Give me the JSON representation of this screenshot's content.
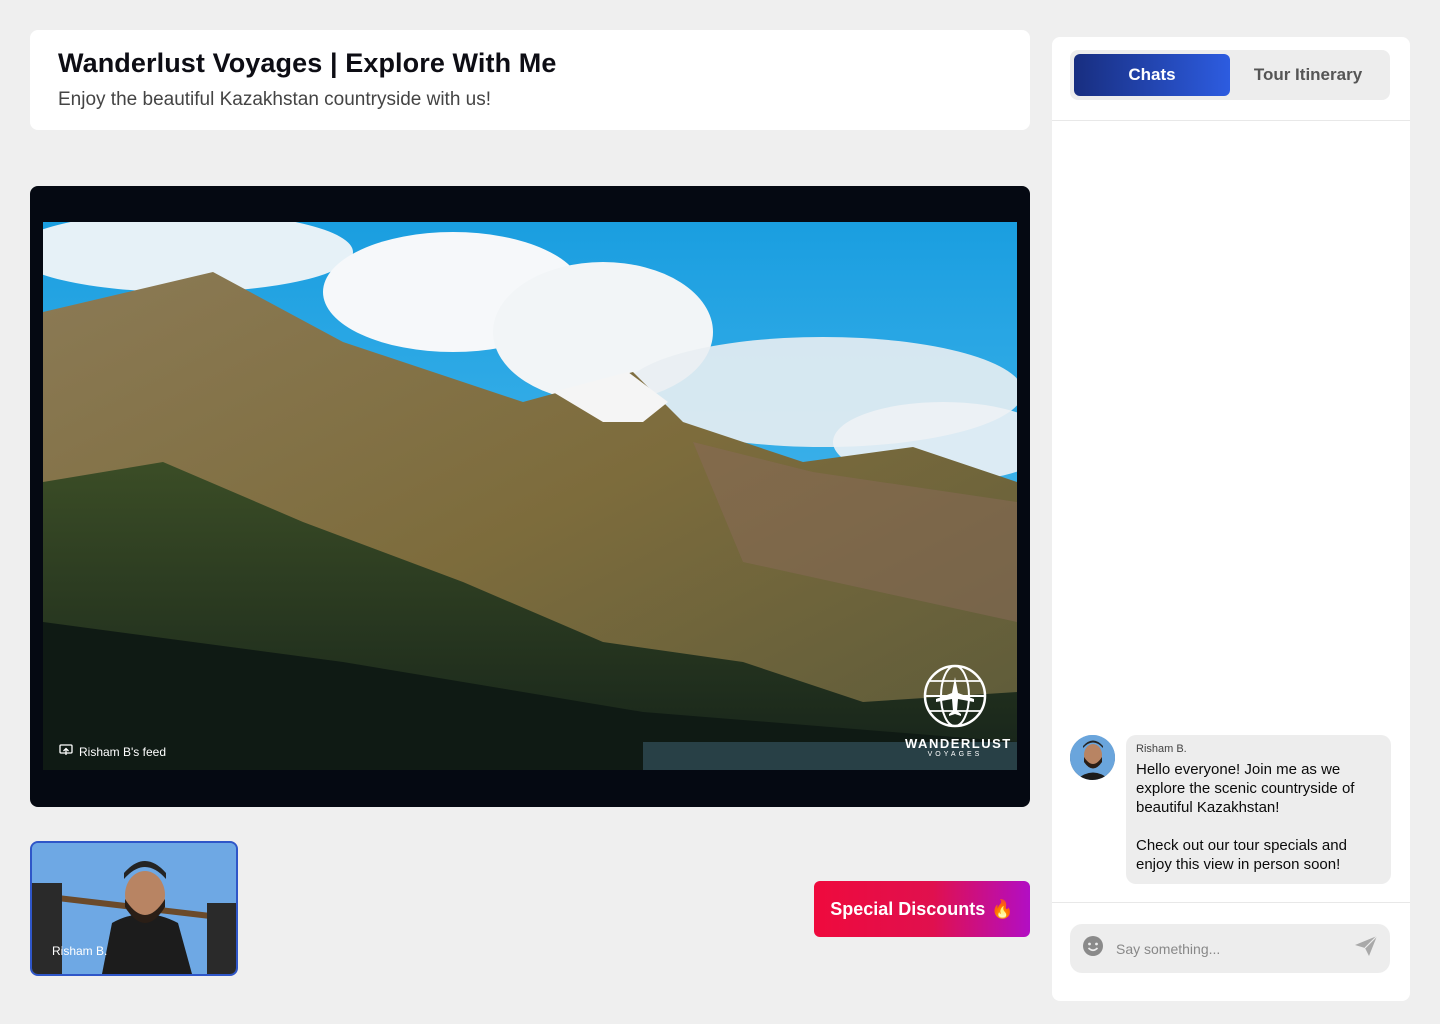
{
  "header": {
    "title": "Wanderlust Voyages | Explore With Me",
    "subtitle": "Enjoy the beautiful Kazakhstan countryside with us!"
  },
  "video": {
    "feed_label": "Risham B's feed",
    "brand_name": "WANDERLUST",
    "brand_sub": "VOYAGES"
  },
  "presenter": {
    "name": "Risham B."
  },
  "promo": {
    "button_label": "Special Discounts",
    "button_emoji": "🔥"
  },
  "sidebar": {
    "tabs": [
      {
        "label": "Chats",
        "active": true
      },
      {
        "label": "Tour Itinerary",
        "active": false
      }
    ],
    "messages": [
      {
        "author": "Risham B.",
        "text": "Hello everyone! Join me as we explore the scenic countryside of beautiful Kazakhstan!\n\nCheck out our tour specials and enjoy this view in person soon!"
      }
    ],
    "composer": {
      "placeholder": "Say something..."
    }
  },
  "colors": {
    "background": "#efefef",
    "tab_active_start": "#182e80",
    "tab_active_end": "#2d5ce0",
    "promo_start": "#ef0a3d",
    "promo_end": "#b20ec4",
    "tile_border": "#2f56c8"
  },
  "icons": {
    "feed": "screen-share-icon",
    "emoji": "emoji-icon",
    "send": "send-icon",
    "logo": "globe-plane-logo"
  }
}
